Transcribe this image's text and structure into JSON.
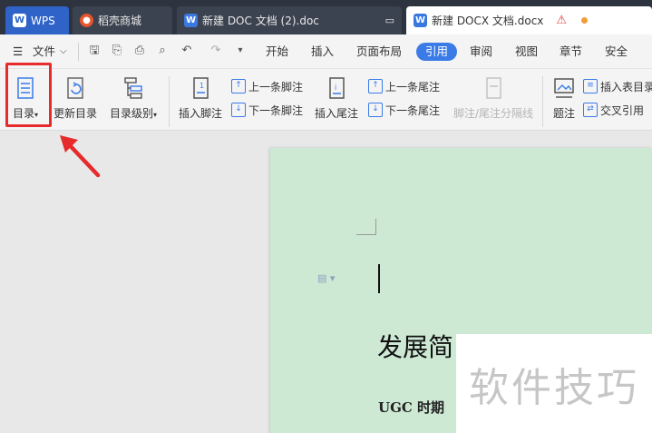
{
  "tabs": [
    {
      "label": "WPS",
      "icon": "wps-logo-icon"
    },
    {
      "label": "稻壳商城",
      "icon": "docer-icon"
    },
    {
      "label": "新建 DOC 文档 (2).doc",
      "icon": "word-doc-icon"
    },
    {
      "label": "新建 DOCX 文档.docx",
      "icon": "word-doc-icon"
    }
  ],
  "menubar": {
    "file_label": "文件",
    "items": [
      "开始",
      "插入",
      "页面布局",
      "引用",
      "审阅",
      "视图",
      "章节",
      "安全"
    ],
    "active": "引用"
  },
  "ribbon": {
    "toc": "目录",
    "update_toc": "更新目录",
    "toc_level": "目录级别",
    "insert_footnote": "插入脚注",
    "prev_footnote": "上一条脚注",
    "next_footnote": "下一条脚注",
    "insert_endnote": "插入尾注",
    "prev_endnote": "上一条尾注",
    "next_endnote": "下一条尾注",
    "separator": "脚注/尾注分隔线",
    "caption": "题注",
    "insert_table_toc": "插入表目录",
    "cross_ref": "交叉引用"
  },
  "document": {
    "heading": "发展简",
    "subheading": "UGC 时期"
  },
  "watermark": "软件技巧",
  "colors": {
    "accent": "#3b7be8",
    "highlight": "#e52b2b",
    "page": "#cde8d3"
  }
}
